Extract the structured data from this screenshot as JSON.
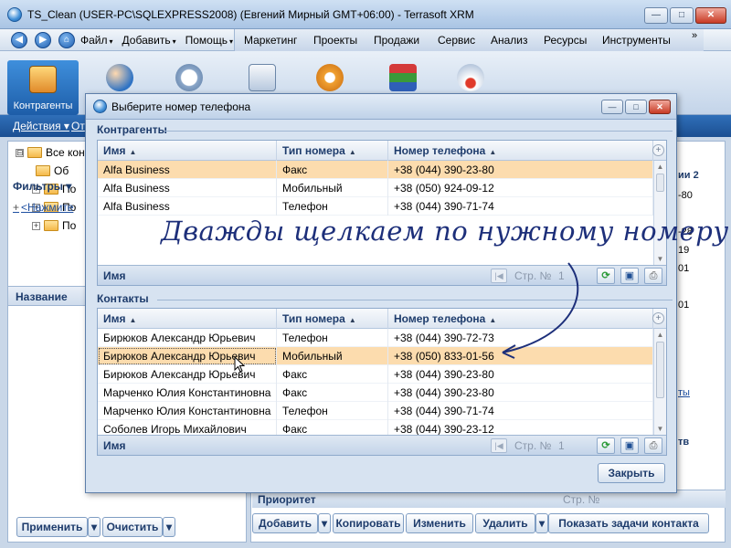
{
  "window": {
    "title": "TS_Clean (USER-PC\\SQLEXPRESS2008) (Евгений Мирный GMT+06:00) - Terrasoft XRM",
    "minimize": "—",
    "maximize": "□",
    "close": "✕"
  },
  "menu": {
    "left": [
      {
        "label": "Файл",
        "arrow": "▾"
      },
      {
        "label": "Добавить",
        "arrow": "▾"
      },
      {
        "label": "Помощь",
        "arrow": "▾"
      }
    ],
    "right": [
      "Маркетинг",
      "Проекты",
      "Продажи",
      "Сервис",
      "Анализ",
      "Ресурсы",
      "Инструменты"
    ],
    "overflow": "»"
  },
  "modules": {
    "active_label": "Контрагенты"
  },
  "subbar": {
    "actions": "Действия ▾",
    "other": "От"
  },
  "tree": [
    {
      "label": "Все конт",
      "expander": "⊟"
    },
    {
      "label": "Об",
      "expander": ""
    },
    {
      "label": "По",
      "expander": "+"
    },
    {
      "label": "По",
      "expander": "+"
    },
    {
      "label": "По",
      "expander": "+"
    }
  ],
  "left": {
    "name_header": "Название",
    "filters": "Фильтры ▾",
    "add_filter_prefix": "+",
    "add_filter": "<Нажмите",
    "apply": "Применить",
    "clear": "Очистить",
    "dropdown": "▾"
  },
  "background_grid": {
    "header": "ии 2",
    "values": [
      "-80",
      "-28",
      "19",
      "01",
      "01"
    ],
    "link": "ты",
    "col": "тв",
    "priority": "Приоритет",
    "page": "Стр. №"
  },
  "bottom_buttons": {
    "add": "Добавить",
    "copy": "Копировать",
    "edit": "Изменить",
    "delete": "Удалить",
    "show_tasks": "Показать задачи контакта",
    "dropdown": "▾"
  },
  "dialog": {
    "title": "Выберите номер телефона",
    "minimize": "—",
    "maximize": "□",
    "close": "✕",
    "close_button": "Закрыть",
    "columns": {
      "name": "Имя",
      "type": "Тип номера",
      "number": "Номер телефона",
      "sort": "▲",
      "add": "+"
    },
    "pager": {
      "first": "|◀",
      "prev": "◀",
      "page_label": "Стр. №",
      "page_value": "1",
      "next": "▶"
    },
    "tools": {
      "refresh": "⟳",
      "save": "▣",
      "print": "⎙"
    },
    "accounts": {
      "title": "Контрагенты",
      "footer_name": "Имя",
      "rows": [
        {
          "name": "Alfa Business",
          "type": "Факс",
          "number": "+38 (044) 390-23-80",
          "selected": true
        },
        {
          "name": "Alfa Business",
          "type": "Мобильный",
          "number": "+38 (050) 924-09-12",
          "selected": false
        },
        {
          "name": "Alfa Business",
          "type": "Телефон",
          "number": "+38 (044) 390-71-74",
          "selected": false
        }
      ]
    },
    "contacts": {
      "title": "Контакты",
      "footer_name": "Имя",
      "rows": [
        {
          "name": "Бирюков Александр Юрьевич",
          "type": "Телефон",
          "number": "+38 (044) 390-72-73",
          "selected": false
        },
        {
          "name": "Бирюков Александр Юрьевич",
          "type": "Мобильный",
          "number": "+38 (050) 833-01-56",
          "selected": true
        },
        {
          "name": "Бирюков Александр Юрьевич",
          "type": "Факс",
          "number": "+38 (044) 390-23-80",
          "selected": false
        },
        {
          "name": "Марченко Юлия Константиновна",
          "type": "Факс",
          "number": "+38 (044) 390-23-80",
          "selected": false
        },
        {
          "name": "Марченко Юлия Константиновна",
          "type": "Телефон",
          "number": "+38 (044) 390-71-74",
          "selected": false
        },
        {
          "name": "Соболев Игорь Михайлович",
          "type": "Факс",
          "number": "+38 (044) 390-23-12",
          "selected": false
        }
      ]
    }
  },
  "annotation": "Дважды щелкаем по нужному номеру",
  "colors": {
    "accent_blue": "#1d5da8",
    "selection": "#fcdcae",
    "annotation_ink": "#1d2f7a"
  },
  "icons": {
    "app": "terrasoft-logo-icon",
    "back": "back-arrow-icon",
    "forward": "forward-arrow-icon",
    "home": "home-icon"
  }
}
